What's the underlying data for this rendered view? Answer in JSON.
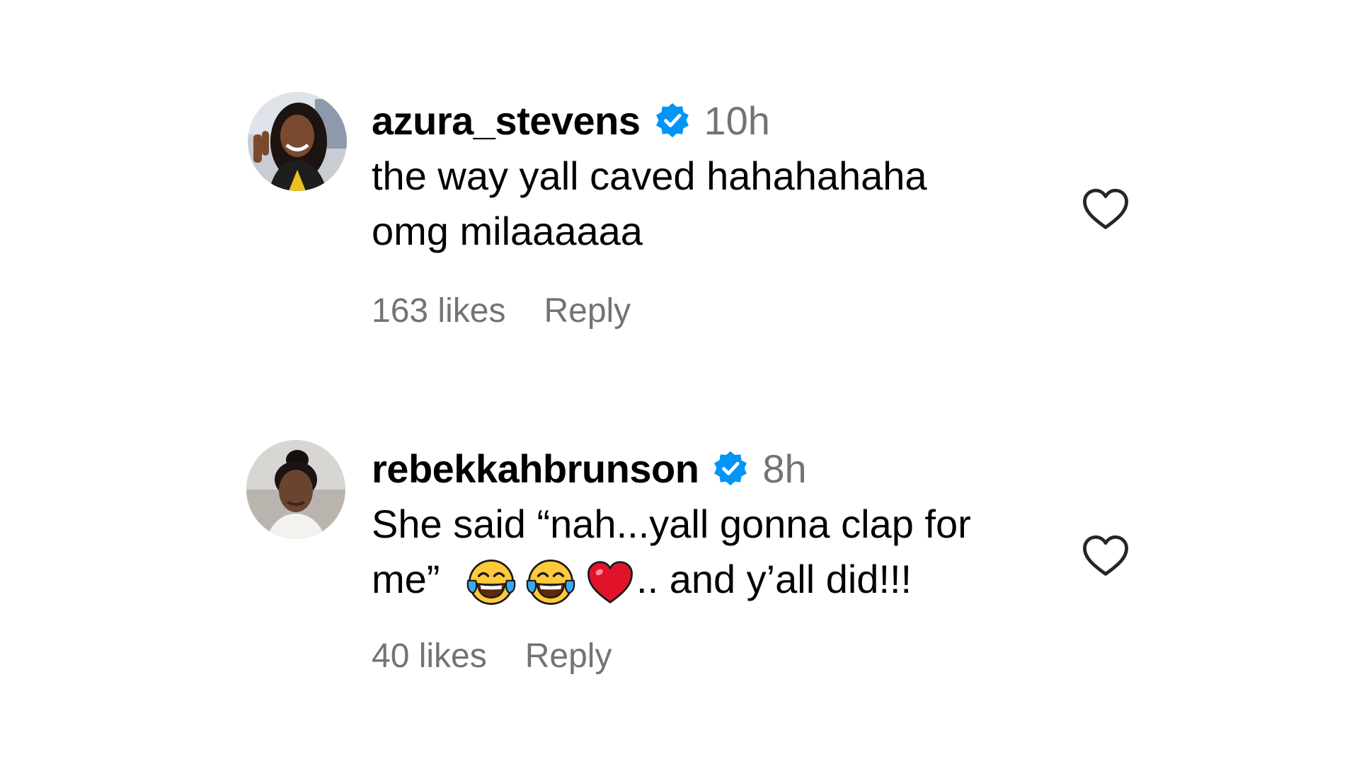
{
  "comments": [
    {
      "username": "azura_stevens",
      "verified": true,
      "time": "10h",
      "text_lines": [
        "the way yall caved hahahahaha",
        "omg milaaaaaa"
      ],
      "likes": "163 likes",
      "reply_label": "Reply"
    },
    {
      "username": "rebekkahbrunson",
      "verified": true,
      "time": "8h",
      "text_line1": "She said “nah...yall gonna clap for",
      "text_line2_start": "me”",
      "text_line2_end": ".. and y’all did!!!",
      "emojis": [
        "face-with-tears-of-joy",
        "face-with-tears-of-joy",
        "red-heart"
      ],
      "likes": "40 likes",
      "reply_label": "Reply"
    }
  ],
  "icons": {
    "verified_badge": "verified-badge-icon",
    "like": "heart-outline-icon"
  },
  "colors": {
    "verified_blue": "#0095F6",
    "muted_text": "#737373",
    "text": "#000000",
    "heart_emoji": "#E0132B",
    "emoji_face": "#FFC93A",
    "tears": "#3AA8F2"
  }
}
